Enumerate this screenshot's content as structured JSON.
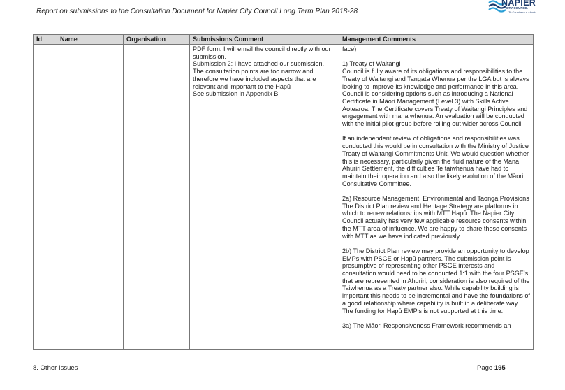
{
  "header": {
    "title": "Report on submissions to the Consultation Document for Napier City Council Long Term Plan 2018-28",
    "logo": {
      "name": "NAPIER",
      "sub": "CITY COUNCIL",
      "tagline": "Te Kaunihera o Ahuriri",
      "icon": "wave-icon"
    }
  },
  "table": {
    "headers": [
      "Id",
      "Name",
      "Organisation",
      "Submissions Comment",
      "Management Comments"
    ],
    "row": {
      "id": "",
      "name": "",
      "organisation": "",
      "submission": "PDF form.  I will email the council directly with our submission.\nSubmission 2: I have attached our submission. The consultation points are too narrow and therefore we have included aspects that are relevant and important to the Hapū\nSee submission in Appendix B",
      "management": [
        "face)",
        "1) Treaty of Waitangi\nCouncil is fully aware of its obligations and responsibilities to the Treaty of Waitangi and Tangata Whenua per the LGA but is always looking to improve its knowledge and performance in this area.  Council is considering options such as introducing a National Certificate in Māori Management (Level 3) with Skills Active Aotearoa.  The Certificate covers Treaty of Waitangi Principles and engagement with mana whenua.  An evaluation will be conducted with the initial pilot group before rolling out wider across Council.",
        "If an independent review of obligations and responsibilities was conducted this would be in consultation with the Ministry of Justice Treaty of Waitangi Commitments Unit.  We would question whether this is necessary, particularly given the fluid nature of the Mana Ahuriri Settlement, the difficulties Te taiwhenua have had to maintain their operation and also the likely evolution of the Māori Consultative Committee.",
        "2a) Resource Management; Environmental and Taonga Provisions\nThe District Plan review and Heritage Strategy are platforms in which to renew relationships with MTT Hapū. The Napier City Council actually has very few applicable resource consents within the MTT area of influence. We are happy to share those consents with MTT as we have indicated previously.",
        "2b) The District Plan review may provide an opportunity to develop EMPs with PSGE or Hapū partners.  The submission point is presumptive of representing other PSGE interests and consultation would need to be conducted 1:1 with the four PSGE's that are represented in Ahuriri, consideration is also required of the Taiwhenua as a Treaty partner also.  While capability building is important this needs to be incremental and have the foundations of a good relationship where capability is built in a deliberate way.  The funding for Hapū EMP's is not supported at this time.",
        "3a) The Māori Responsiveness Framework recommends an"
      ]
    }
  },
  "footer": {
    "section": "8. Other Issues",
    "page_label": "Page",
    "page_number": "195"
  }
}
